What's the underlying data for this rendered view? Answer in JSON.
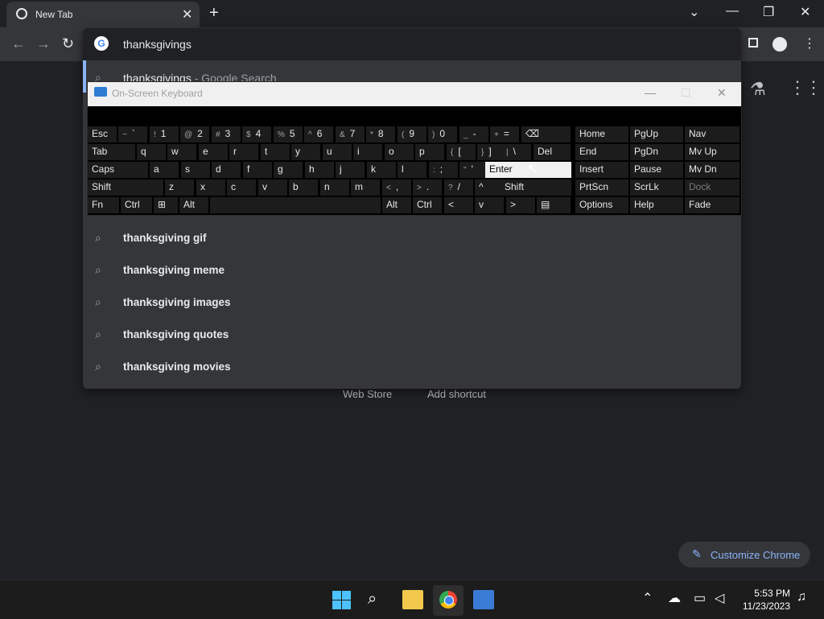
{
  "browser": {
    "tab_title": "New Tab",
    "tab_close": "✕",
    "new_tab": "+",
    "win_controls": {
      "chevron": "⌄",
      "minimize": "—",
      "restore": "❐",
      "close": "✕"
    }
  },
  "toolbar": {
    "back": "←",
    "forward": "→",
    "reload": "↻"
  },
  "omnibox": {
    "query": "thanksgivings",
    "first_suggestion": "thanksgivings",
    "first_suggestion_suffix": " - Google Search",
    "suggestions": [
      "thanksgiving gif",
      "thanksgiving meme",
      "thanksgiving images",
      "thanksgiving quotes",
      "thanksgiving movies"
    ]
  },
  "ntp": {
    "web_store": "Web Store",
    "add_shortcut": "Add shortcut",
    "customize": "Customize Chrome"
  },
  "osk": {
    "title": "On-Screen Keyboard",
    "rows": [
      [
        {
          "sh": "",
          "mn": "Esc"
        },
        {
          "sh": "~",
          "mn": "`"
        },
        {
          "sh": "!",
          "mn": "1"
        },
        {
          "sh": "@",
          "mn": "2"
        },
        {
          "sh": "#",
          "mn": "3"
        },
        {
          "sh": "$",
          "mn": "4"
        },
        {
          "sh": "%",
          "mn": "5"
        },
        {
          "sh": "^",
          "mn": "6"
        },
        {
          "sh": "&",
          "mn": "7"
        },
        {
          "sh": "*",
          "mn": "8"
        },
        {
          "sh": "(",
          "mn": "9"
        },
        {
          "sh": ")",
          "mn": "0"
        },
        {
          "sh": "_",
          "mn": "-"
        },
        {
          "sh": "+",
          "mn": "="
        },
        {
          "sh": "",
          "mn": "⌫"
        },
        {
          "sh": "",
          "mn": "Home"
        },
        {
          "sh": "",
          "mn": "PgUp"
        },
        {
          "sh": "",
          "mn": "Nav"
        }
      ],
      [
        {
          "sh": "",
          "mn": "Tab"
        },
        {
          "sh": "",
          "mn": "q"
        },
        {
          "sh": "",
          "mn": "w"
        },
        {
          "sh": "",
          "mn": "e"
        },
        {
          "sh": "",
          "mn": "r"
        },
        {
          "sh": "",
          "mn": "t"
        },
        {
          "sh": "",
          "mn": "y"
        },
        {
          "sh": "",
          "mn": "u"
        },
        {
          "sh": "",
          "mn": "i"
        },
        {
          "sh": "",
          "mn": "o"
        },
        {
          "sh": "",
          "mn": "p"
        },
        {
          "sh": "{",
          "mn": "["
        },
        {
          "sh": "}",
          "mn": "]"
        },
        {
          "sh": "|",
          "mn": "\\"
        },
        {
          "sh": "",
          "mn": "Del"
        },
        {
          "sh": "",
          "mn": "End"
        },
        {
          "sh": "",
          "mn": "PgDn"
        },
        {
          "sh": "",
          "mn": "Mv Up"
        }
      ],
      [
        {
          "sh": "",
          "mn": "Caps"
        },
        {
          "sh": "",
          "mn": "a"
        },
        {
          "sh": "",
          "mn": "s"
        },
        {
          "sh": "",
          "mn": "d"
        },
        {
          "sh": "",
          "mn": "f"
        },
        {
          "sh": "",
          "mn": "g"
        },
        {
          "sh": "",
          "mn": "h"
        },
        {
          "sh": "",
          "mn": "j"
        },
        {
          "sh": "",
          "mn": "k"
        },
        {
          "sh": "",
          "mn": "l"
        },
        {
          "sh": ":",
          "mn": ";"
        },
        {
          "sh": "\"",
          "mn": "'"
        },
        {
          "sh": "",
          "mn": "Enter"
        },
        {
          "sh": "",
          "mn": "Insert"
        },
        {
          "sh": "",
          "mn": "Pause"
        },
        {
          "sh": "",
          "mn": "Mv Dn"
        }
      ],
      [
        {
          "sh": "",
          "mn": "Shift"
        },
        {
          "sh": "",
          "mn": "z"
        },
        {
          "sh": "",
          "mn": "x"
        },
        {
          "sh": "",
          "mn": "c"
        },
        {
          "sh": "",
          "mn": "v"
        },
        {
          "sh": "",
          "mn": "b"
        },
        {
          "sh": "",
          "mn": "n"
        },
        {
          "sh": "",
          "mn": "m"
        },
        {
          "sh": "<",
          "mn": ","
        },
        {
          "sh": ">",
          "mn": "."
        },
        {
          "sh": "?",
          "mn": "/"
        },
        {
          "sh": "",
          "mn": "^"
        },
        {
          "sh": "",
          "mn": "Shift"
        },
        {
          "sh": "",
          "mn": "PrtScn"
        },
        {
          "sh": "",
          "mn": "ScrLk"
        },
        {
          "sh": "",
          "mn": "Dock"
        }
      ],
      [
        {
          "sh": "",
          "mn": "Fn"
        },
        {
          "sh": "",
          "mn": "Ctrl"
        },
        {
          "sh": "",
          "mn": "⊞"
        },
        {
          "sh": "",
          "mn": "Alt"
        },
        {
          "sh": "",
          "mn": ""
        },
        {
          "sh": "",
          "mn": "Alt"
        },
        {
          "sh": "",
          "mn": "Ctrl"
        },
        {
          "sh": "",
          "mn": "<"
        },
        {
          "sh": "",
          "mn": "v"
        },
        {
          "sh": "",
          "mn": ">"
        },
        {
          "sh": "",
          "mn": "▤"
        },
        {
          "sh": "",
          "mn": "Options"
        },
        {
          "sh": "",
          "mn": "Help"
        },
        {
          "sh": "",
          "mn": "Fade"
        }
      ]
    ]
  },
  "taskbar": {
    "time": "5:53 PM",
    "date": "11/23/2023"
  }
}
